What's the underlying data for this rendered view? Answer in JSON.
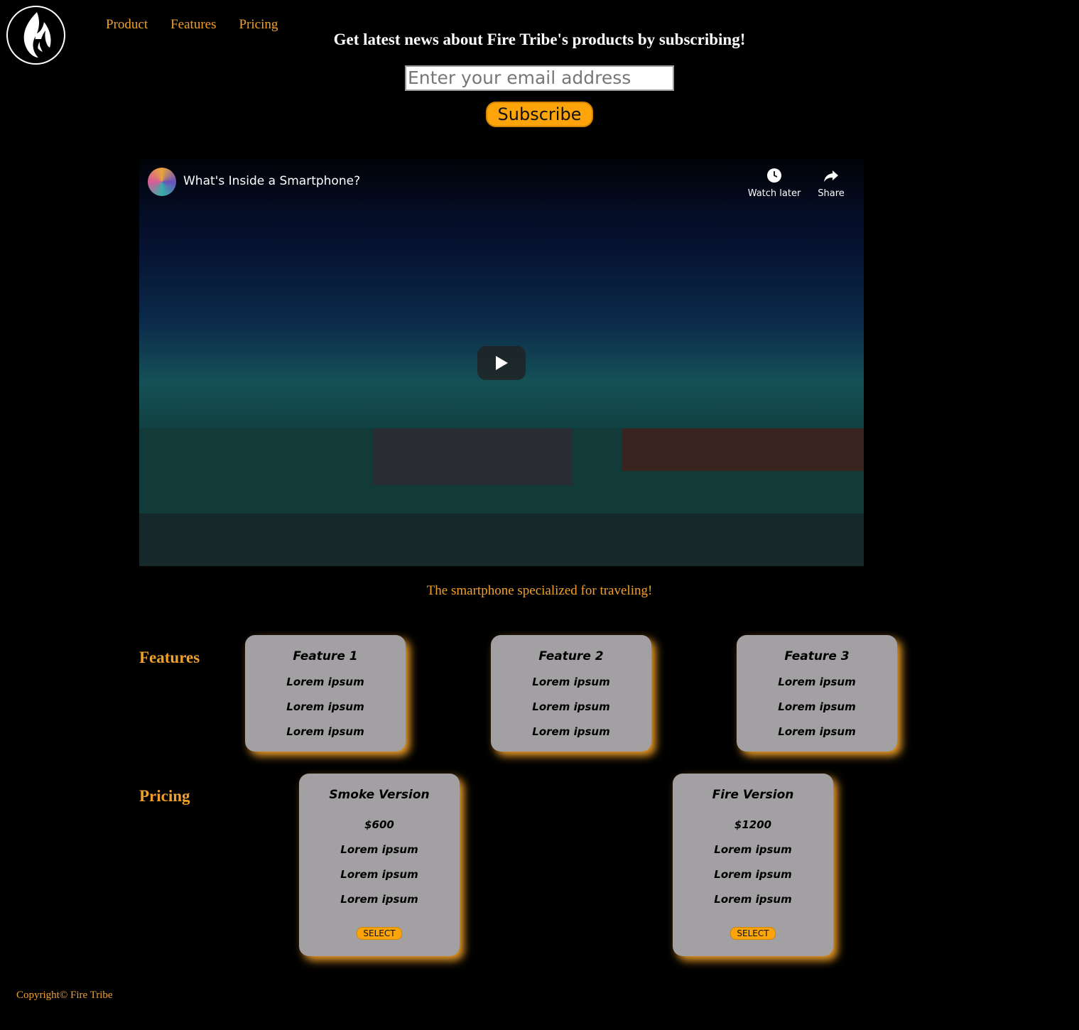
{
  "nav": {
    "items": [
      "Product",
      "Features",
      "Pricing"
    ]
  },
  "subscribe": {
    "title": "Get latest news about Fire Tribe's products by subscribing!",
    "email_placeholder": "Enter your email address",
    "button_label": "Subscribe"
  },
  "video": {
    "title": "What's Inside a Smartphone?",
    "watch_later": "Watch later",
    "share": "Share"
  },
  "tagline": "The smartphone specialized for traveling!",
  "features": {
    "heading": "Features",
    "cards": [
      {
        "title": "Feature 1",
        "items": [
          "Lorem ipsum",
          "Lorem ipsum",
          "Lorem ipsum"
        ]
      },
      {
        "title": "Feature 2",
        "items": [
          "Lorem ipsum",
          "Lorem ipsum",
          "Lorem ipsum"
        ]
      },
      {
        "title": "Feature 3",
        "items": [
          "Lorem ipsum",
          "Lorem ipsum",
          "Lorem ipsum"
        ]
      }
    ]
  },
  "pricing": {
    "heading": "Pricing",
    "cards": [
      {
        "title": "Smoke Version",
        "price": "$600",
        "items": [
          "Lorem ipsum",
          "Lorem ipsum",
          "Lorem ipsum"
        ],
        "button": "SELECT"
      },
      {
        "title": "Fire Version",
        "price": "$1200",
        "items": [
          "Lorem ipsum",
          "Lorem ipsum",
          "Lorem ipsum"
        ],
        "button": "SELECT"
      }
    ]
  },
  "footer": {
    "copyright": "Copyright© Fire Tribe"
  },
  "colors": {
    "accent": "#f0a02a",
    "button": "#fca40a",
    "card": "#a2a0a2",
    "background": "#000000"
  }
}
